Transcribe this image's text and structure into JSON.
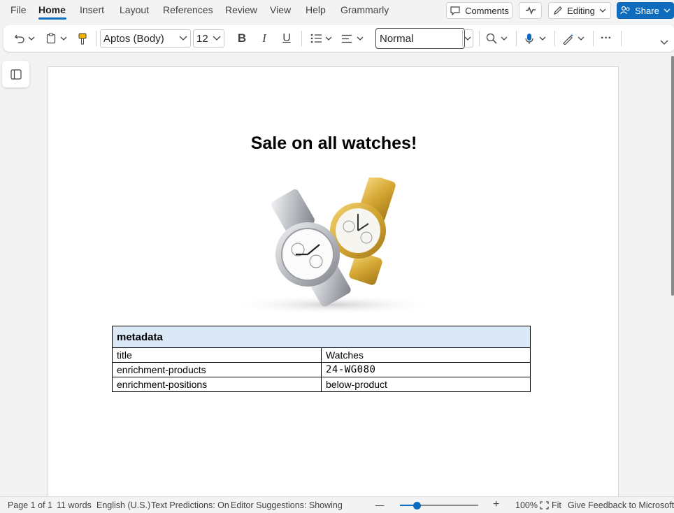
{
  "menu": {
    "items": [
      "File",
      "Home",
      "Insert",
      "Layout",
      "References",
      "Review",
      "View",
      "Help",
      "Grammarly"
    ],
    "active": "Home"
  },
  "top_actions": {
    "comments_label": "Comments",
    "editing_label": "Editing",
    "share_label": "Share"
  },
  "ribbon": {
    "font_name": "Aptos (Body)",
    "font_size": "12",
    "style": "Normal",
    "bold_label": "B",
    "italic_label": "I",
    "underline_label": "U",
    "more_label": "···"
  },
  "document": {
    "title": "Sale on all watches!",
    "table": {
      "header": "metadata",
      "rows": [
        {
          "key": "title",
          "value": "Watches"
        },
        {
          "key": "enrichment-products",
          "value": "24-WG080"
        },
        {
          "key": "enrichment-positions",
          "value": "below-product"
        }
      ]
    }
  },
  "status": {
    "page": "Page 1 of 1",
    "words": "11 words",
    "language": "English (U.S.)",
    "text_predictions": "Text Predictions: On",
    "editor_suggestions": "Editor Suggestions: Showing",
    "zoom_minus": "—",
    "zoom_plus": "+",
    "zoom_level": "100%",
    "zoom_fraction": 0.22,
    "fit_label": "Fit",
    "feedback": "Give Feedback to Microsoft"
  },
  "colors": {
    "accent": "#0f6cbd",
    "table_header_bg": "#dbe9f7",
    "watch_gold": "#d4a531",
    "watch_silver": "#c9ccd0"
  }
}
